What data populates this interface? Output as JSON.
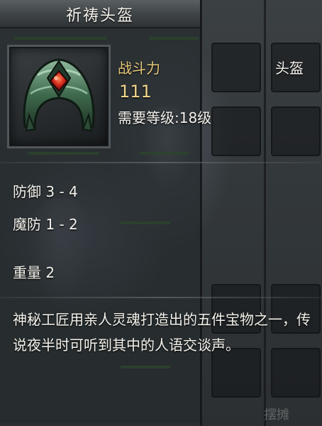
{
  "item": {
    "name": "祈祷头盔",
    "power_label": "战斗力",
    "power_value": "111",
    "slot_type": "头盔",
    "required_level": "需要等级:18级",
    "attributes": [
      {
        "text": "防御 3 - 4"
      },
      {
        "text": "魔防 1 - 2"
      },
      {
        "text": "重量 2"
      }
    ],
    "description": "神秘工匠用亲人灵魂打造出的五件宝物之一，传说夜半时可听到其中的人语交谈声。",
    "icon": "helmet-icon"
  },
  "background": {
    "button_label": "摆摊"
  },
  "colors": {
    "title_text": "#f3f1ea",
    "power_label": "#e8c87a",
    "power_value": "#f1d58a",
    "body_text": "#f4f2ec",
    "gem_red": "#d0281c",
    "helmet_green": "#3f6a4d"
  }
}
